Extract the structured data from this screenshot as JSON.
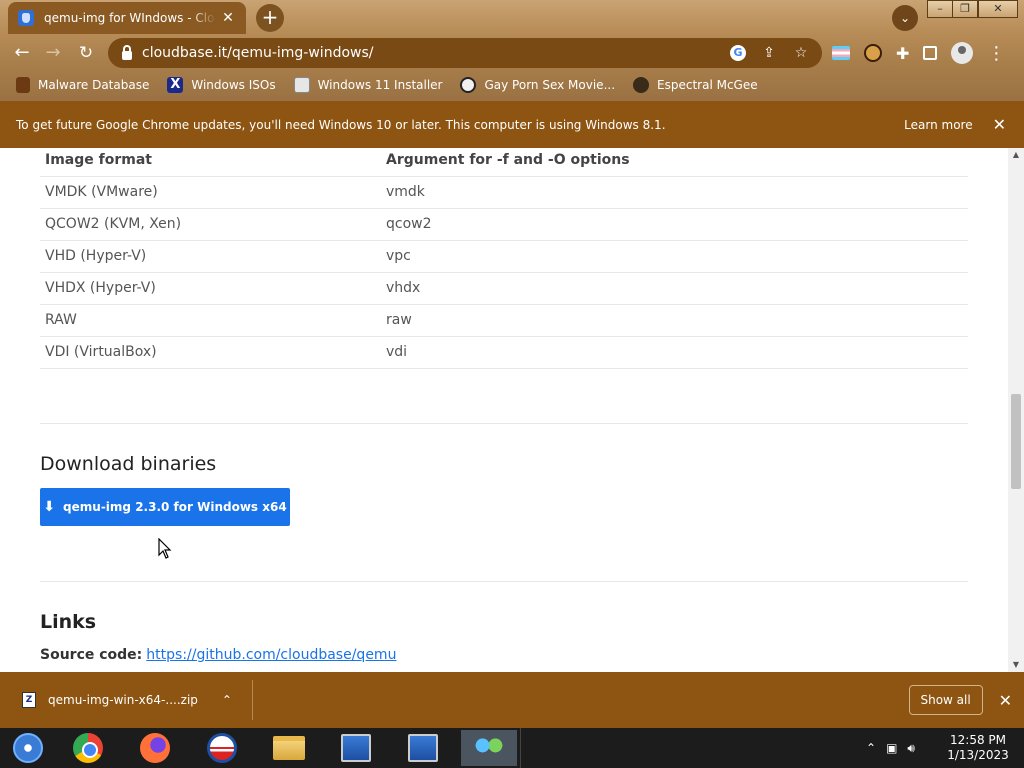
{
  "browser": {
    "tab_title": "qemu-img for WIndows - Cloudbase",
    "tab_close": "✕",
    "new_tab": "+",
    "url": "cloudbase.it/qemu-img-windows/",
    "bookmarks": [
      {
        "label": "Malware Database"
      },
      {
        "label": "Windows ISOs",
        "icon_text": "X"
      },
      {
        "label": "Windows 11 Installer"
      },
      {
        "label": "Gay Porn Sex Movie..."
      },
      {
        "label": "Espectral McGee"
      }
    ]
  },
  "infobar": {
    "message": "To get future Google Chrome updates, you'll need Windows 10 or later. This computer is using Windows 8.1.",
    "learn_more": "Learn more",
    "close": "✕"
  },
  "formats_table": {
    "headers": [
      "Image format",
      "Argument for -f and -O options"
    ],
    "rows": [
      [
        "VMDK (VMware)",
        "vmdk"
      ],
      [
        "QCOW2 (KVM, Xen)",
        "qcow2"
      ],
      [
        "VHD (Hyper-V)",
        "vpc"
      ],
      [
        "VHDX (Hyper-V)",
        "vhdx"
      ],
      [
        "RAW",
        "raw"
      ],
      [
        "VDI (VirtualBox)",
        "vdi"
      ]
    ]
  },
  "download": {
    "heading": "Download binaries",
    "button_label": "qemu-img 2.3.0 for Windows x64"
  },
  "links": {
    "heading": "Links",
    "source_label": "Source code:",
    "source_url": "https://github.com/cloudbase/qemu"
  },
  "shelf": {
    "file_name": "qemu-img-win-x64-....zip",
    "file_icon_text": "Z",
    "show_all": "Show all",
    "close": "✕"
  },
  "taskbar": {
    "time": "12:58 PM",
    "date": "1/13/2023"
  },
  "colors": {
    "chrome_accent": "#8e5411",
    "download_button": "#1a73e8",
    "link": "#1a73e8"
  }
}
